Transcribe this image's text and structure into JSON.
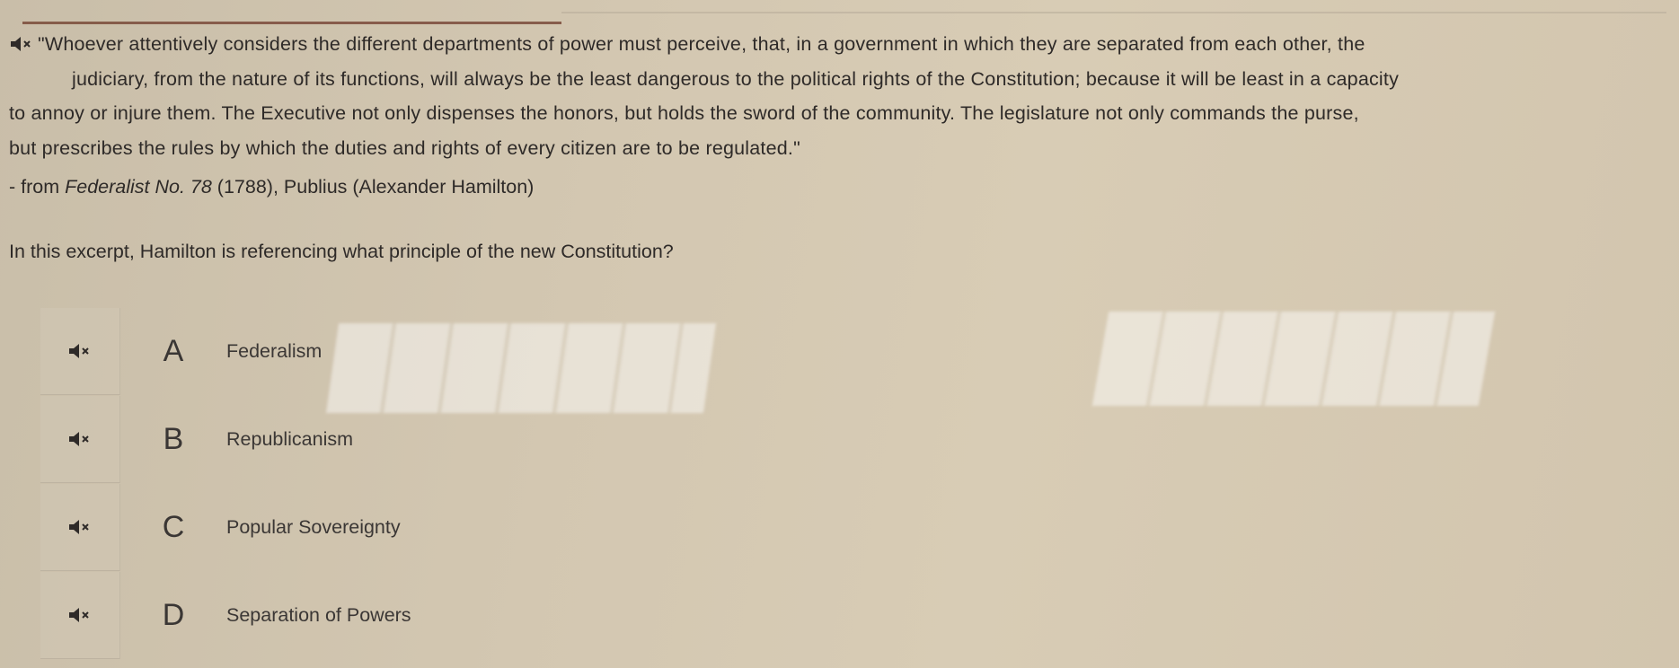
{
  "passage": {
    "lines": [
      "\"Whoever attentively considers the different departments of power must perceive, that, in a government in which they are separated from each other, the",
      "judiciary, from the nature of its functions, will always be the least dangerous to the political rights of the Constitution; because it will be least in a capacity",
      "to annoy or injure them. The Executive not only dispenses the honors, but holds the sword of the community. The legislature not only commands the purse,",
      "but prescribes the rules by which the duties and rights of every citizen are to be regulated.\""
    ],
    "citation_prefix": "- from ",
    "citation_work": "Federalist No. 78",
    "citation_suffix": " (1788), Publius (Alexander Hamilton)"
  },
  "question": "In this excerpt, Hamilton is referencing what principle of the new Constitution?",
  "choices": [
    {
      "letter": "A",
      "text": "Federalism"
    },
    {
      "letter": "B",
      "text": "Republicanism"
    },
    {
      "letter": "C",
      "text": "Popular Sovereignty"
    },
    {
      "letter": "D",
      "text": "Separation of Powers"
    }
  ],
  "icons": {
    "audio": "speaker-muted-icon"
  }
}
